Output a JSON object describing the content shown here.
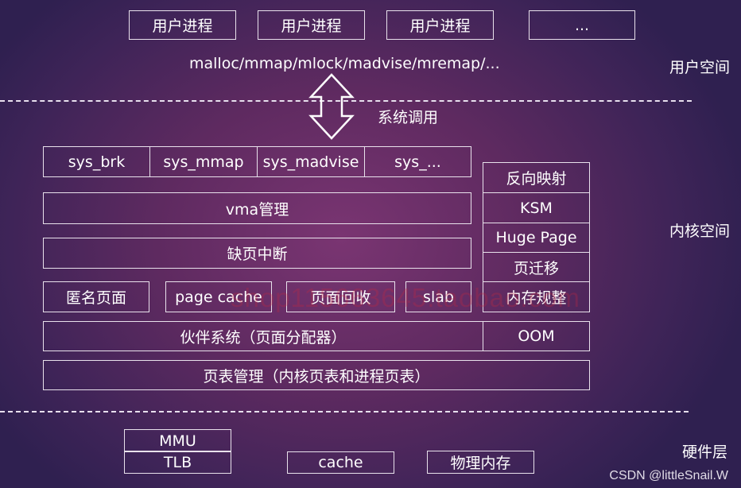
{
  "user_space": {
    "processes": [
      "用户进程",
      "用户进程",
      "用户进程",
      "..."
    ],
    "api_text": "malloc/mmap/mlock/madvise/mremap/...",
    "label": "用户空间"
  },
  "syscall": {
    "label": "系统调用",
    "arrow_icon": "double-arrow-vertical"
  },
  "kernel_space": {
    "label": "内核空间",
    "syscalls": [
      "sys_brk",
      "sys_mmap",
      "sys_madvise",
      "sys_..."
    ],
    "vma": "vma管理",
    "page_fault": "缺页中断",
    "row_items": [
      "匿名页面",
      "page cache",
      "页面回收",
      "slab"
    ],
    "buddy": "伙伴系统（页面分配器）",
    "page_table": "页表管理（内核页表和进程页表）",
    "side_column": [
      "反向映射",
      "KSM",
      "Huge Page",
      "页迁移",
      "内存规整"
    ],
    "oom": "OOM"
  },
  "hardware": {
    "label": "硬件层",
    "mmu": "MMU",
    "tlb": "TLB",
    "cache": "cache",
    "memory": "物理内存"
  },
  "watermark": "shop115663645.taobao.com",
  "credit": "CSDN @littleSnail.W"
}
